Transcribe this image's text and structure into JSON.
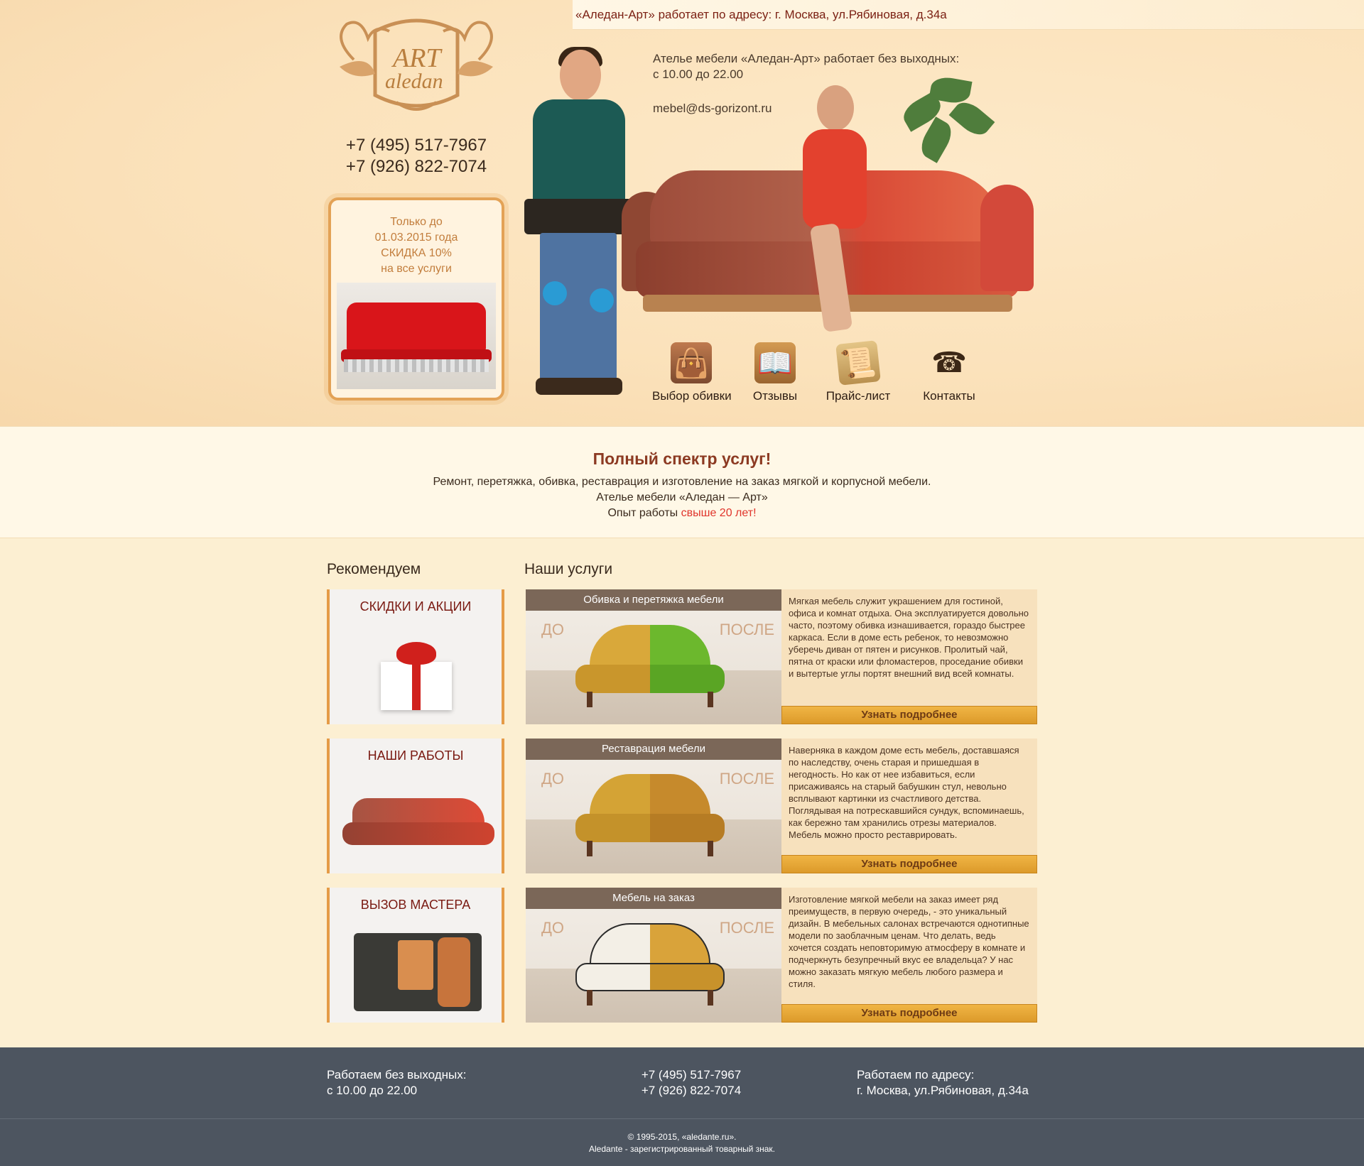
{
  "header": {
    "address_line": "«Аледан-Арт» работает по адресу: г. Москва, ул.Рябиновая, д.34а",
    "logo": {
      "word1": "ART",
      "word2": "aledan"
    },
    "phones": [
      "+7 (495) 517-7967",
      "+7 (926) 822-7074"
    ],
    "promo": {
      "line1": "Только до",
      "line2": "01.03.2015 года",
      "line3": "СКИДКА 10%",
      "line4": "на все услуги"
    },
    "info": {
      "line1": "Ателье мебели «Аледан-Арт» работает без выходных:",
      "line2": "с 10.00 до 22.00",
      "email": "mebel@ds-gorizont.ru"
    },
    "nav": [
      {
        "label": "Выбор обивки",
        "icon": "bag-icon"
      },
      {
        "label": "Отзывы",
        "icon": "book-icon"
      },
      {
        "label": "Прайс-лист",
        "icon": "paper-icon"
      },
      {
        "label": "Контакты",
        "icon": "phone-icon"
      }
    ]
  },
  "intro": {
    "title": "Полный спектр услуг!",
    "line1": "Ремонт, перетяжка, обивка, реставрация и изготовление на заказ мягкой и корпусной мебели.",
    "line2": "Ателье мебели «Аледан — Арт»",
    "line3_prefix": "Опыт работы ",
    "line3_accent": "свыше 20 лет!"
  },
  "recommend": {
    "title": "Рекомендуем",
    "cards": [
      {
        "title": "СКИДКИ И АКЦИИ"
      },
      {
        "title": "НАШИ РАБОТЫ"
      },
      {
        "title": "ВЫЗОВ МАСТЕРА"
      }
    ]
  },
  "services": {
    "title": "Наши услуги",
    "before_label": "ДО",
    "after_label": "ПОСЛЕ",
    "more_label": "Узнать подробнее",
    "items": [
      {
        "name": "Обивка и перетяжка мебели",
        "text": "Мягкая мебель служит украшением для гостиной, офиса и комнат отдыха. Она эксплуатируется довольно часто, поэтому обивка изнашивается, гораздо быстрее каркаса. Если в доме есть ребенок, то невозможно уберечь диван от пятен и рисунков. Пролитый чай, пятна от краски или фломастеров, проседание обивки и вытертые углы портят внешний вид всей комнаты.",
        "before_color": "#d9a83a",
        "after_color": "#6cb82d"
      },
      {
        "name": "Реставрация мебели",
        "text": "Наверняка в каждом доме есть мебель, доставшаяся по наследству, очень старая и пришедшая в негодность. Но как от нее избавиться, если присаживаясь на старый бабушкин стул, невольно всплывают картинки из счастливого детства. Поглядывая на потрескавшийся сундук, вспоминаешь, как бережно там хранились отрезы материалов. Мебель можно просто реставрировать.",
        "before_color": "#d4a335",
        "after_color": "#c68a2c"
      },
      {
        "name": "Мебель на заказ",
        "text": "Изготовление мягкой мебели на заказ имеет ряд преимуществ, в первую очередь, - это уникальный дизайн. В мебельных салонах встречаются однотипные модели по заоблачным ценам. Что делать, ведь хочется создать неповторимую атмосферу в комнате и подчеркнуть безупречный вкус ее владельца? У нас можно заказать мягкую мебель любого размера и стиля.",
        "before_color": "#f3efe6",
        "after_color": "#d9a33a"
      }
    ]
  },
  "footer": {
    "hours_title": "Работаем без выходных:",
    "hours": "с 10.00 до 22.00",
    "phone1": "+7 (495) 517-7967",
    "phone2": "+7 (926) 822-7074",
    "address_title": "Работаем по адресу:",
    "address": "г. Москва, ул.Рябиновая, д.34а",
    "copyright": "© 1995-2015, «aledante.ru».",
    "trademark": "Aledante - зарегистрированный товарный знак."
  }
}
